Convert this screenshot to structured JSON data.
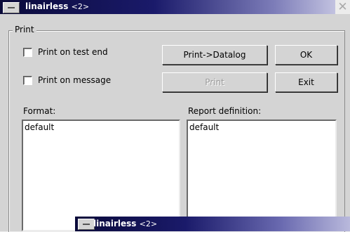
{
  "window": {
    "title_name": "linairless",
    "title_suffix": "<2>",
    "close_glyph": "✕"
  },
  "print_group": {
    "label": "Print",
    "checkboxes": [
      {
        "label": "Print on test end",
        "checked": false
      },
      {
        "label": "Print on message",
        "checked": false
      }
    ],
    "buttons": {
      "datalog": "Print->Datalog",
      "ok": "OK",
      "print": "Print",
      "exit": "Exit"
    },
    "format": {
      "label": "Format:",
      "items": [
        "default"
      ]
    },
    "report": {
      "label": "Report definition:",
      "items": [
        "default"
      ]
    }
  },
  "sub_window": {
    "title_name": "linairless",
    "title_suffix": "<2>"
  },
  "colors": {
    "titlebar_dark": "#0a0a3a",
    "window_bg": "#d4d4d4"
  }
}
